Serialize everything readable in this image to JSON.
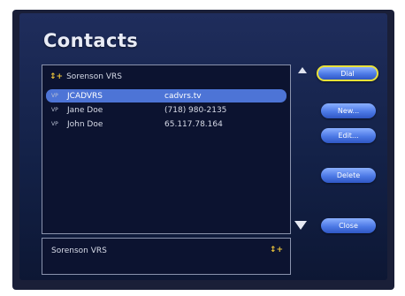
{
  "page": {
    "title": "Contacts"
  },
  "list": {
    "header": {
      "label": "Sorenson VRS",
      "icon": "sorenson-logo-icon"
    },
    "rows": [
      {
        "icon": "videophone-icon",
        "name": "JCADVRS",
        "address": "cadvrs.tv",
        "selected": true
      },
      {
        "icon": "videophone-icon",
        "name": "Jane Doe",
        "address": "(718) 980-2135",
        "selected": false
      },
      {
        "icon": "videophone-icon",
        "name": "John Doe",
        "address": "65.117.78.164",
        "selected": false
      }
    ]
  },
  "buttons": {
    "dial": "Dial",
    "new": "New...",
    "edit": "Edit...",
    "delete": "Delete",
    "close": "Close"
  },
  "detail": {
    "name": "Sorenson VRS",
    "icon": "sorenson-logo-icon"
  },
  "colors": {
    "selection": "#4d74d6",
    "focus": "#e9e23a",
    "button": "#4d7ae6"
  }
}
